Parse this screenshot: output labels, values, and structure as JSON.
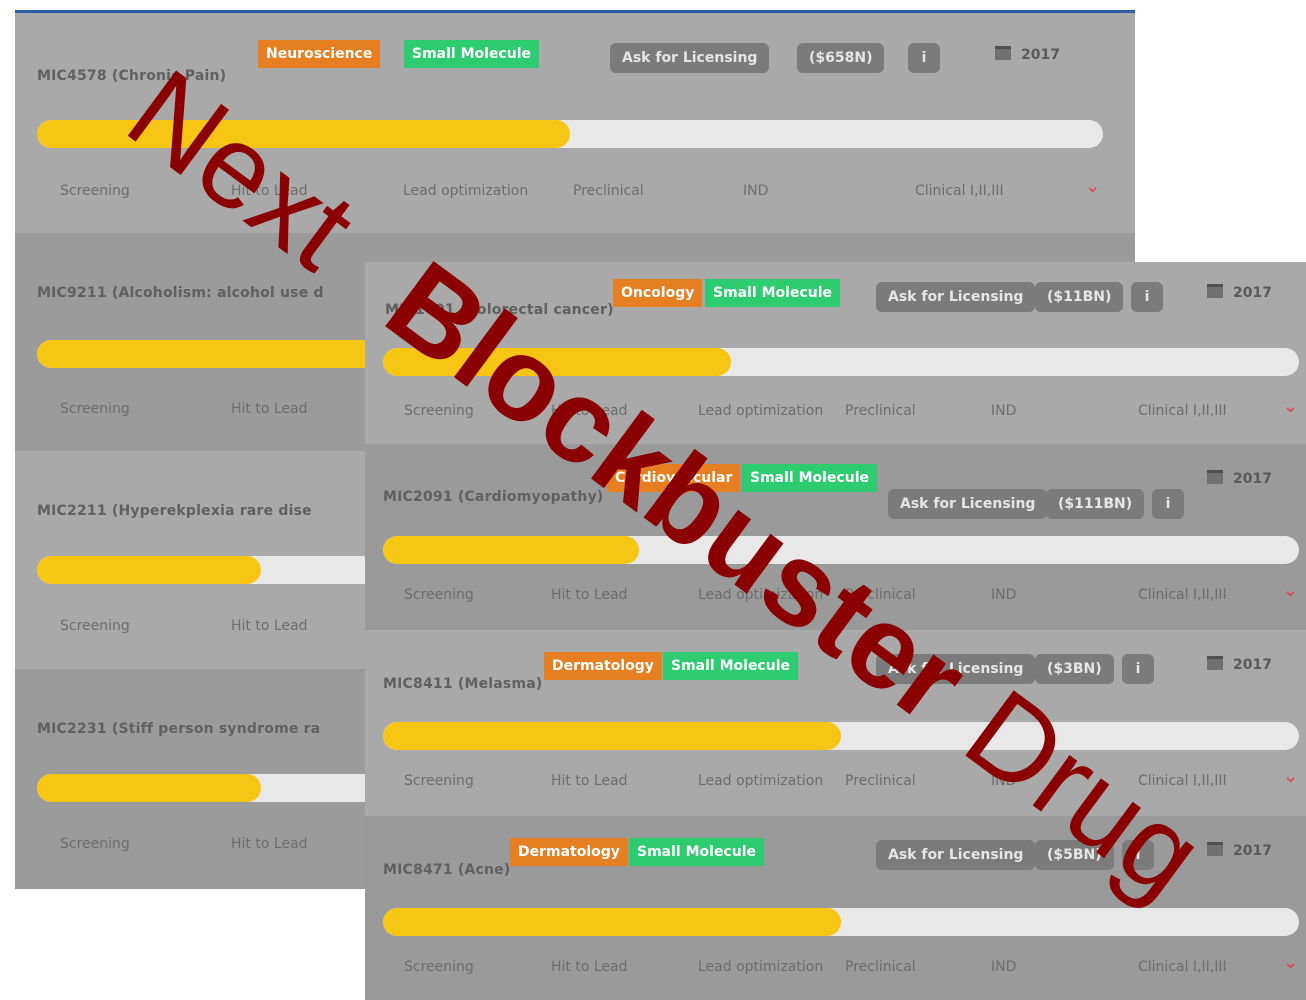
{
  "stages": [
    "Screening",
    "Hit to Lead",
    "Lead optimization",
    "Preclinical",
    "IND",
    "Clinical I,II,III"
  ],
  "back_rows": [
    {
      "name": "MIC4578 (Chronic Pain)",
      "area": "Neuroscience",
      "modality": "Small Molecule",
      "licensing": "Ask for Licensing",
      "value": "($658N)",
      "info": "i",
      "year": "2017",
      "progress": 0.5
    },
    {
      "name": "MIC9211 (Alcoholism: alcohol use d",
      "progress": 0.33
    },
    {
      "name": "MIC2211 (Hyperekplexia rare dise",
      "progress": 0.21
    },
    {
      "name": "MIC2231 (Stiff person syndrome ra",
      "progress": 0.21
    }
  ],
  "front_rows": [
    {
      "name": "MIC1001 (Colorectal cancer)",
      "area": "Oncology",
      "modality": "Small Molecule",
      "licensing": "Ask for Licensing",
      "value": "($11BN)",
      "info": "i",
      "year": "2017",
      "progress": 0.38
    },
    {
      "name": "MIC2091 (Cardiomyopathy)",
      "area": "Cardiovascular",
      "modality": "Small Molecule",
      "licensing": "Ask for Licensing",
      "value": "($111BN)",
      "info": "i",
      "year": "2017",
      "progress": 0.28
    },
    {
      "name": "MIC8411 (Melasma)",
      "area": "Dermatology",
      "modality": "Small Molecule",
      "licensing": "Ask for Licensing",
      "value": "($3BN)",
      "info": "i",
      "year": "2017",
      "progress": 0.5
    },
    {
      "name": "MIC8471 (Acne)",
      "area": "Dermatology",
      "modality": "Small Molecule",
      "licensing": "Ask for Licensing",
      "value": "($5BN)",
      "info": "i",
      "year": "2017",
      "progress": 0.5
    }
  ],
  "watermark": {
    "word1": "Next",
    "word2": "Blockbuster",
    "word3": "Drug",
    "color": "#8b0000"
  },
  "colors": {
    "progress": "#f7c514",
    "area_tag": "#e67e22",
    "modality_tag": "#2ecc71",
    "chevron": "#d94a5a"
  },
  "icons": {
    "calendar": "calendar-icon",
    "chevron": "chevron-down-icon",
    "info": "info-icon"
  }
}
